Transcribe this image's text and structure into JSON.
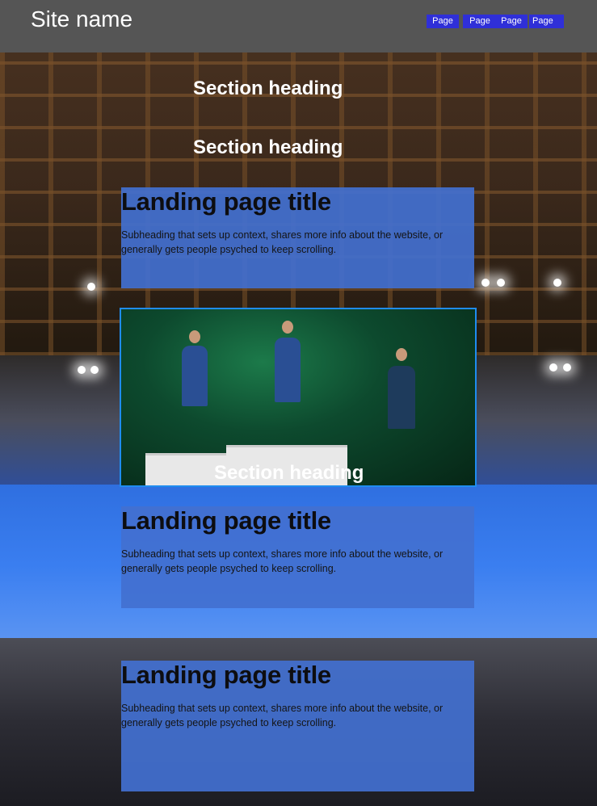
{
  "header": {
    "site_name": "Site name",
    "nav": [
      "Page",
      "Page",
      "Page",
      "Page"
    ]
  },
  "sections": {
    "heading_1": "Section heading",
    "heading_2": "Section heading",
    "heading_3": "Section heading"
  },
  "cards": [
    {
      "title": "Landing page title",
      "subheading": "Subheading that sets up context, shares more info about the website, or generally gets people psyched to keep scrolling."
    },
    {
      "title": "Landing page title",
      "subheading": "Subheading that sets up context, shares more info about the website, or generally gets people psyched to keep scrolling."
    },
    {
      "title": "Landing page title",
      "subheading": "Subheading that sets up context, shares more info about the website, or generally gets people psyched to keep scrolling."
    }
  ],
  "colors": {
    "header_bg": "#555555",
    "nav_button": "#2f2fd8",
    "card_bg": "#4270d0",
    "photo_border": "#1f8cf0"
  }
}
